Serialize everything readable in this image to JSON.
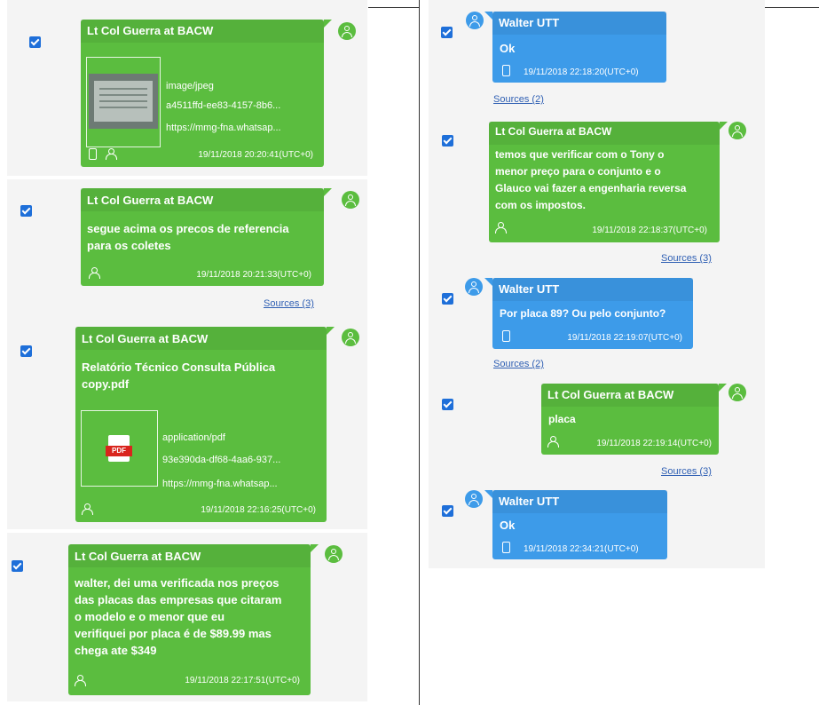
{
  "colors": {
    "green_bubble": "#5bbd3f",
    "blue_bubble": "#3d9be9",
    "checkbox": "#1e6fd9",
    "link": "#2f5fb3",
    "pdf_red": "#d9251d"
  },
  "left": {
    "m1": {
      "sender": "Lt Col Guerra at BACW",
      "mime": "image/jpeg",
      "file_id": "a4511ffd-ee83-4157-8b6...",
      "url": "https://mmg-fna.whatsap...",
      "timestamp": "19/11/2018 20:20:41(UTC+0)"
    },
    "m2": {
      "sender": "Lt Col Guerra at BACW",
      "text_line1": "segue acima os precos de referencia",
      "text_line2": "para os coletes",
      "timestamp": "19/11/2018 20:21:33(UTC+0)",
      "sources": "Sources (3)"
    },
    "m3": {
      "sender": "Lt Col Guerra at BACW",
      "title_line1": "Relatório Técnico Consulta Pública",
      "title_line2": "copy.pdf",
      "pdf_label": "PDF",
      "mime": "application/pdf",
      "file_id": "93e390da-df68-4aa6-937...",
      "url": "https://mmg-fna.whatsap...",
      "timestamp": "19/11/2018 22:16:25(UTC+0)"
    },
    "m4": {
      "sender": "Lt Col Guerra at BACW",
      "lines": [
        "walter, dei uma verificada nos preços",
        "das placas das empresas que citaram",
        "o modelo e o menor que eu",
        "verifiquei por placa é de $89.99 mas",
        "chega ate $349"
      ],
      "timestamp": "19/11/2018 22:17:51(UTC+0)"
    }
  },
  "right": {
    "m1": {
      "sender": "Walter UTT",
      "text": "Ok",
      "timestamp": "19/11/2018 22:18:20(UTC+0)",
      "sources": "Sources (2)"
    },
    "m2": {
      "sender": "Lt Col Guerra at BACW",
      "lines": [
        "temos que verificar com o Tony o",
        "menor preço para o conjunto e o",
        "Glauco vai fazer a engenharia reversa",
        "com os impostos."
      ],
      "timestamp": "19/11/2018 22:18:37(UTC+0)",
      "sources": "Sources (3)"
    },
    "m3": {
      "sender": "Walter UTT",
      "text": "Por placa 89? Ou pelo conjunto?",
      "timestamp": "19/11/2018 22:19:07(UTC+0)",
      "sources": "Sources (2)"
    },
    "m4": {
      "sender": "Lt Col Guerra at BACW",
      "text": "placa",
      "timestamp": "19/11/2018 22:19:14(UTC+0)",
      "sources": "Sources (3)"
    },
    "m5": {
      "sender": "Walter UTT",
      "text": "Ok",
      "timestamp": "19/11/2018 22:34:21(UTC+0)"
    }
  }
}
